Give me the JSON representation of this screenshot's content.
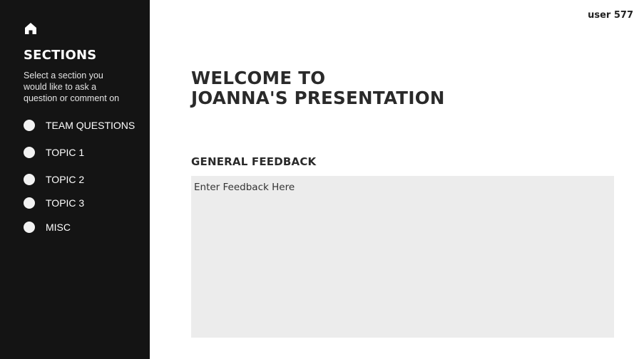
{
  "user": {
    "label": "user 577"
  },
  "sidebar": {
    "home_icon": "home-icon",
    "title": "SECTIONS",
    "description": "Select a section you would like to ask a question or comment on",
    "items": [
      {
        "label": "TEAM QUESTIONS"
      },
      {
        "label": "TOPIC 1"
      },
      {
        "label": "TOPIC 2"
      },
      {
        "label": "TOPIC 3"
      },
      {
        "label": "MISC"
      }
    ]
  },
  "main": {
    "welcome_line1": "WELCOME TO",
    "welcome_line2": "JOANNA'S PRESENTATION",
    "feedback_heading": "GENERAL FEEDBACK",
    "feedback_placeholder": "Enter Feedback Here",
    "feedback_value": ""
  },
  "colors": {
    "sidebar_bg": "#141414",
    "feedback_bg": "#ececec",
    "text_dark": "#2a2a2a"
  }
}
